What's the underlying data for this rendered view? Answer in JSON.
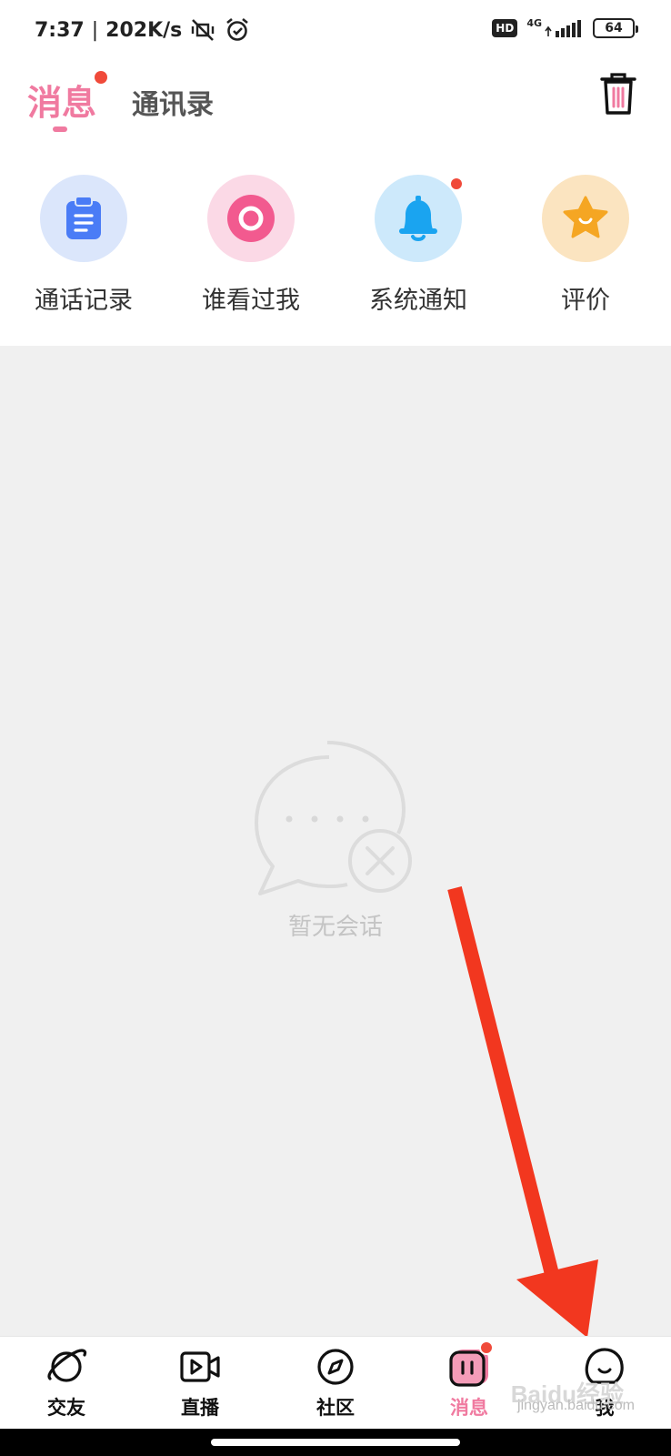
{
  "status_bar": {
    "time": "7:37",
    "separator": "|",
    "speed": "202K/s",
    "hd_label": "HD",
    "network_label": "4G",
    "battery": "64"
  },
  "header": {
    "active_tab": "消息",
    "contacts_tab": "通讯录"
  },
  "quick_actions": [
    {
      "label": "通话记录",
      "icon": "clipboard-icon",
      "color": "#4a7cf6",
      "bg": "#dbe6fb"
    },
    {
      "label": "谁看过我",
      "icon": "eye-circle-icon",
      "color": "#f25a8f",
      "bg": "#fbd9e6"
    },
    {
      "label": "系统通知",
      "icon": "bell-icon",
      "color": "#1aa4f0",
      "bg": "#cde9fb",
      "has_badge": true
    },
    {
      "label": "评价",
      "icon": "star-icon",
      "color": "#f5a623",
      "bg": "#fbe4c0"
    }
  ],
  "empty_state": {
    "text": "暂无会话"
  },
  "bottom_nav": [
    {
      "label": "交友",
      "icon": "planet-icon",
      "active": false
    },
    {
      "label": "直播",
      "icon": "video-icon",
      "active": false
    },
    {
      "label": "社区",
      "icon": "compass-icon",
      "active": false
    },
    {
      "label": "消息",
      "icon": "message-icon",
      "active": true,
      "has_badge": true
    },
    {
      "label": "我",
      "icon": "profile-icon",
      "active": false
    }
  ],
  "watermark": {
    "logo": "Baidu经验",
    "url": "jingyan.baidu.com"
  },
  "colors": {
    "accent": "#f07aa0",
    "badge": "#f04a3a",
    "annotation_arrow": "#f2371f",
    "empty_bg": "#f0f0f0"
  }
}
